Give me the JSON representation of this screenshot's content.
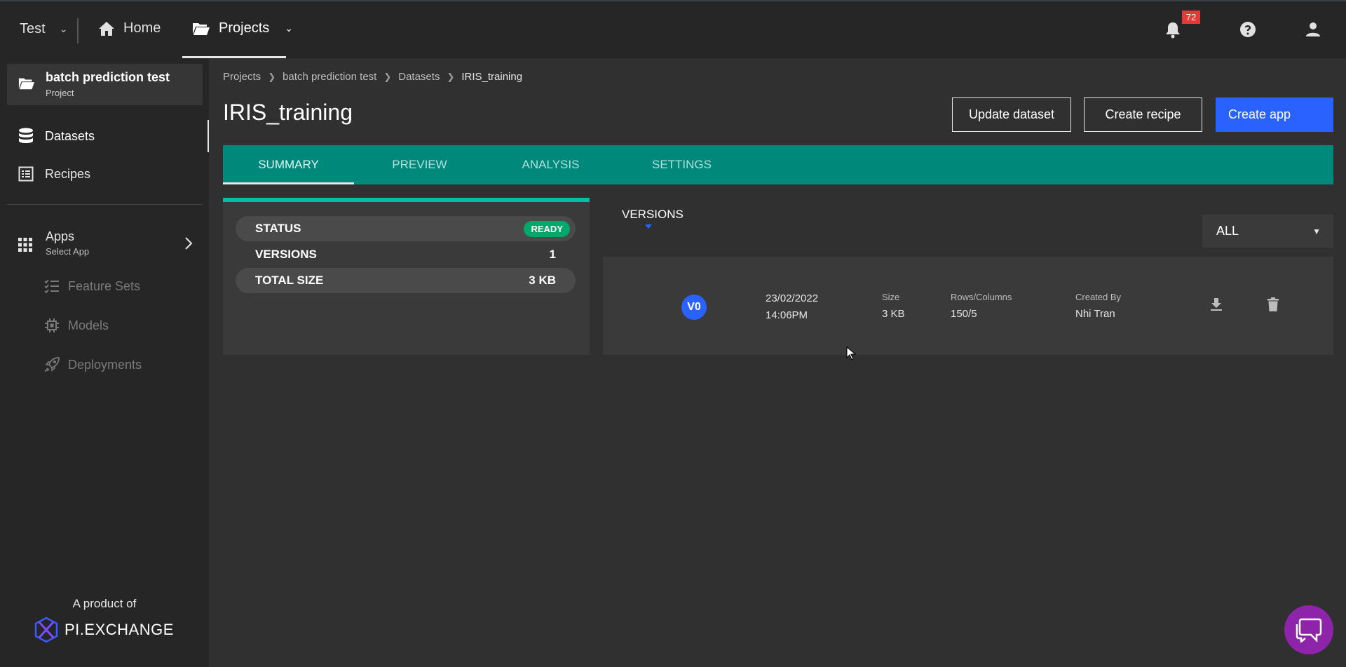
{
  "topbar": {
    "workspace": "Test",
    "home_label": "Home",
    "projects_label": "Projects",
    "notification_count": "72"
  },
  "sidebar": {
    "project_name": "batch prediction test",
    "project_type": "Project",
    "items": [
      {
        "label": "Datasets",
        "active": true
      },
      {
        "label": "Recipes",
        "active": false
      }
    ],
    "apps_label": "Apps",
    "apps_sub": "Select App",
    "sub_items": [
      {
        "label": "Feature Sets"
      },
      {
        "label": "Models"
      },
      {
        "label": "Deployments"
      }
    ],
    "product_of": "A product of",
    "brand": "PI.EXCHANGE"
  },
  "breadcrumb": [
    "Projects",
    "batch prediction test",
    "Datasets",
    "IRIS_training"
  ],
  "page_title": "IRIS_training",
  "actions": {
    "update_dataset": "Update dataset",
    "create_recipe": "Create recipe",
    "create_app": "Create app"
  },
  "tabs": [
    "SUMMARY",
    "PREVIEW",
    "ANALYSIS",
    "SETTINGS"
  ],
  "summary": {
    "status_label": "STATUS",
    "status_value": "READY",
    "versions_label": "VERSIONS",
    "versions_value": "1",
    "size_label": "TOTAL SIZE",
    "size_value": "3 KB"
  },
  "versions": {
    "label": "VERSIONS",
    "filter_value": "ALL",
    "rows": [
      {
        "badge": "V0",
        "date": "23/02/2022",
        "time": "14:06PM",
        "size_label": "Size",
        "size": "3 KB",
        "rc_label": "Rows/Columns",
        "rc": "150/5",
        "created_label": "Created By",
        "created_by": "Nhi Tran"
      }
    ]
  },
  "colors": {
    "accent": "#2962ff",
    "tab_bar": "#00897b",
    "status_ready": "#00a86b",
    "notification": "#e53935",
    "chat": "#8e24aa"
  }
}
